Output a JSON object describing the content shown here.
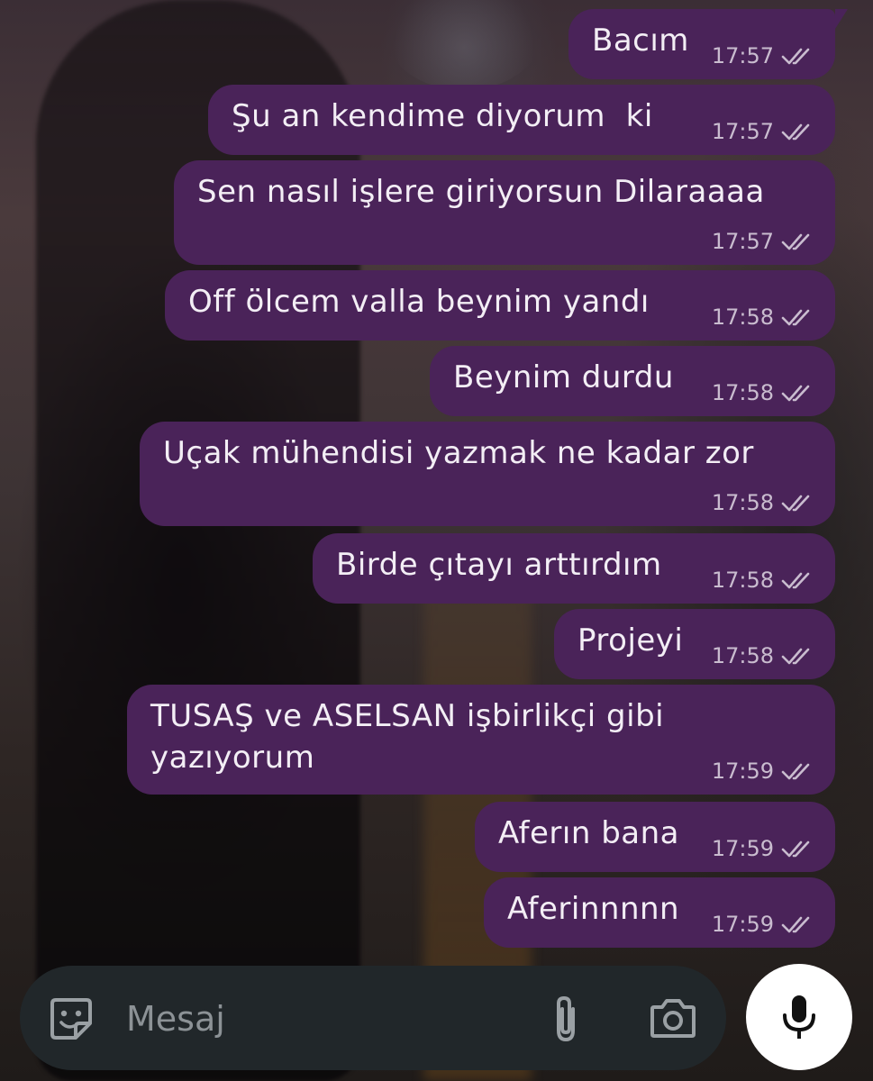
{
  "chat": {
    "messages": [
      {
        "text": "Bacım",
        "time": "17:57",
        "status": "read"
      },
      {
        "text": "Şu an kendime diyorum  ki",
        "time": "17:57",
        "status": "read"
      },
      {
        "text": "Sen nasıl işlere giriyorsun Dilaraaaa",
        "time": "17:57",
        "status": "read"
      },
      {
        "text": "Off ölcem valla beynim yandı",
        "time": "17:58",
        "status": "read"
      },
      {
        "text": "Beynim durdu",
        "time": "17:58",
        "status": "read"
      },
      {
        "text": "Uçak mühendisi yazmak ne kadar zor",
        "time": "17:58",
        "status": "read"
      },
      {
        "text": "Birde çıtayı arttırdım",
        "time": "17:58",
        "status": "read"
      },
      {
        "text": "Projeyi",
        "time": "17:58",
        "status": "read"
      },
      {
        "text": "TUSAŞ ve ASELSAN işbirlikçi gibi\nyazıyorum",
        "time": "17:59",
        "status": "read"
      },
      {
        "text": "Aferın bana",
        "time": "17:59",
        "status": "read"
      },
      {
        "text": "Aferinnnnn",
        "time": "17:59",
        "status": "read"
      }
    ]
  },
  "composer": {
    "placeholder": "Mesaj",
    "emoji_icon": "sticker-emoji-icon",
    "attach_icon": "paperclip-icon",
    "camera_icon": "camera-icon",
    "mic_icon": "microphone-icon"
  },
  "colors": {
    "outgoing_bubble": "#4a2359",
    "composer_bg": "#21272a",
    "mic_button": "#ffffff"
  }
}
